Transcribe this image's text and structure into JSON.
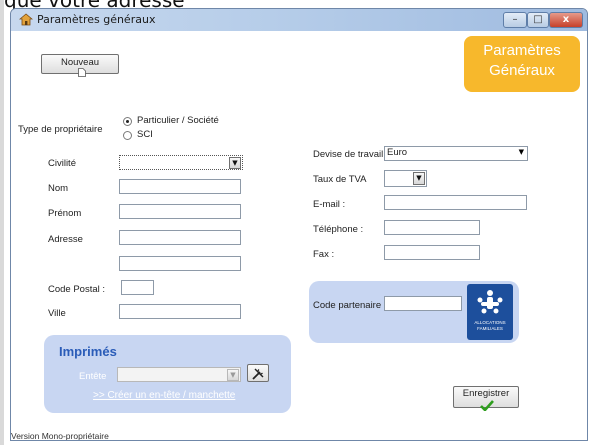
{
  "background_caption": "que votre adresse",
  "window": {
    "title": "Paramètres généraux",
    "controls": {
      "minimize": "–",
      "maximize": "□",
      "close": "x"
    }
  },
  "toolbar": {
    "new_label": "Nouveau"
  },
  "header_badge": {
    "line1": "Paramètres",
    "line2": "Généraux",
    "color": "#f7b82c"
  },
  "owner": {
    "label": "Type de propriétaire",
    "options": [
      {
        "label": "Particulier / Société",
        "selected": true
      },
      {
        "label": "SCI",
        "selected": false
      }
    ]
  },
  "form_left": {
    "civilite_label": "Civilité",
    "civilite_value": "",
    "nom_label": "Nom",
    "prenom_label": "Prénom",
    "adresse_label": "Adresse",
    "code_postal_label": "Code Postal :",
    "ville_label": "Ville"
  },
  "form_right": {
    "devise_label": "Devise de travail",
    "devise_value": "Euro",
    "tva_label": "Taux de TVA",
    "email_label": "E-mail :",
    "telephone_label": "Téléphone :",
    "fax_label": "Fax :"
  },
  "partner": {
    "label": "Code partenaire",
    "value": "",
    "logo_text_line1": "ALLOCATIONS",
    "logo_text_line2": "FAMILIALES",
    "panel_color": "#c8d6f2",
    "logo_color": "#1d4f9c"
  },
  "imprimes": {
    "title": "Imprimés",
    "entete_label": "Entête",
    "entete_value": "",
    "link_text": ">> Créer un en-tête / manchette"
  },
  "save_button": {
    "label": "Enregistrer"
  },
  "status": {
    "text": "Version Mono-propriétaire"
  }
}
